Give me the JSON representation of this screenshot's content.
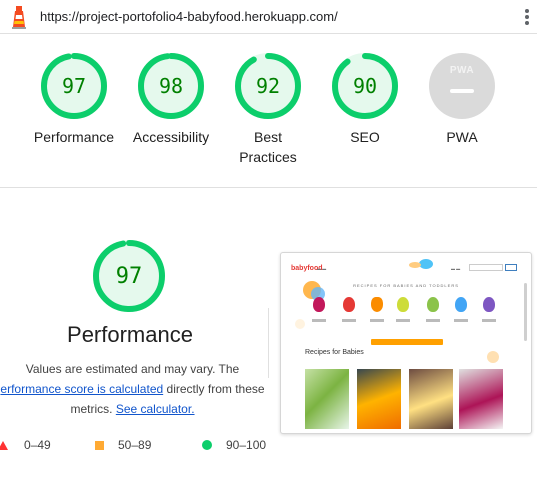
{
  "header": {
    "url": "https://project-portofolio4-babyfood.herokuapp.com/",
    "logo_icon": "lighthouse-icon",
    "menu_icon": "more-vert-icon"
  },
  "scores": [
    {
      "id": "performance",
      "value": "97",
      "label": "Performance",
      "fraction": 0.97
    },
    {
      "id": "accessibility",
      "value": "98",
      "label": "Accessibility",
      "fraction": 0.98
    },
    {
      "id": "best-practices",
      "value": "92",
      "label": "Best Practices",
      "fraction": 0.92
    },
    {
      "id": "seo",
      "value": "90",
      "label": "SEO",
      "fraction": 0.9
    }
  ],
  "pwa": {
    "label": "PWA",
    "badge_text": "PWA"
  },
  "performance_detail": {
    "score": "97",
    "score_fraction": 0.97,
    "title": "Performance",
    "desc_part1": "Values are estimated and may vary. The",
    "desc_link1": "erformance score is calculated",
    "desc_part2": "directly from these",
    "desc_part3": "metrics.",
    "desc_link2": "See calculator."
  },
  "legend": [
    {
      "range": "0–49",
      "color": "#ff3333",
      "shape": "triangle"
    },
    {
      "range": "50–89",
      "color": "#ffaa33",
      "shape": "square"
    },
    {
      "range": "90–100",
      "color": "#0cce6b",
      "shape": "circle"
    }
  ],
  "screenshot": {
    "logo": "babyfood",
    "tagline": "RECIPES FOR BABIES AND TODDLERS",
    "section_heading": "Recipes for Babies"
  },
  "colors": {
    "pass": "#0cce6b",
    "pass_text": "#008000",
    "pass_bg": "#e5f9ed",
    "link": "#1155cc"
  }
}
